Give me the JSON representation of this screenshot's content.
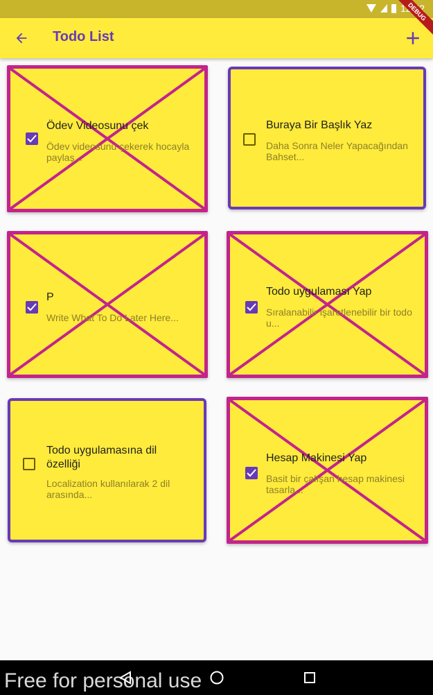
{
  "status_bar": {
    "time": "12:52",
    "debug_label": "DEBUG"
  },
  "app_bar": {
    "title": "Todo List",
    "back_icon": "arrow-left-icon",
    "add_icon": "plus-icon",
    "accent_color": "#673ab7",
    "background_color": "#ffeb3b"
  },
  "todos": [
    {
      "title": "Ödev Videosunu çek",
      "description": "Ödev videosunu çekerek hocayla paylaş...",
      "done": true
    },
    {
      "title": "Buraya Bir Başlık Yaz",
      "description": "Daha Sonra Neler Yapacağından Bahset...",
      "done": false
    },
    {
      "title": "P",
      "description": "Write What To Do Later Here...",
      "done": true
    },
    {
      "title": "Todo uygulaması Yap",
      "description": "Sıralanabilir işaretlenebilir bir todo u...",
      "done": true
    },
    {
      "title": "Todo uygulamasına dil özelliği",
      "description": "Localization kullanılarak 2 dil arasında...",
      "done": false
    },
    {
      "title": "Hesap Makinesi Yap",
      "description": "Basit bir çalışan hesap makinesi tasarla...",
      "done": true
    }
  ],
  "colors": {
    "done_border": "#c2248b",
    "open_border": "#673ab7",
    "card_background": "#ffeb3b"
  },
  "nav_bar": {
    "back_icon": "triangle-back-icon",
    "home_icon": "circle-home-icon",
    "recents_icon": "square-recents-icon"
  },
  "watermark": "Free for personal use"
}
